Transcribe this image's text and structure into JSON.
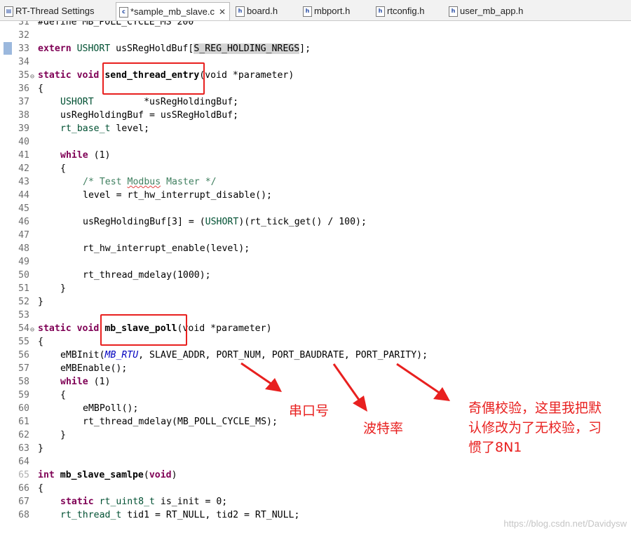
{
  "tabs": [
    {
      "label": "RT-Thread Settings",
      "icon": "settings-icon",
      "icon_glyph": "▤"
    },
    {
      "label": "*sample_mb_slave.c",
      "icon": "c-file-icon",
      "icon_glyph": "c",
      "close": "✕"
    },
    {
      "label": "board.h",
      "icon": "h-file-icon",
      "icon_glyph": "h"
    },
    {
      "label": "mbport.h",
      "icon": "h-file-icon",
      "icon_glyph": "h"
    },
    {
      "label": "rtconfig.h",
      "icon": "h-file-icon",
      "icon_glyph": "h"
    },
    {
      "label": "user_mb_app.h",
      "icon": "h-file-icon",
      "icon_glyph": "h"
    }
  ],
  "lines": {
    "n31": "31",
    "n32": "32",
    "n33": "33",
    "n34": "34",
    "n35": "35",
    "n36": "36",
    "n37": "37",
    "n38": "38",
    "n39": "39",
    "n40": "40",
    "n41": "41",
    "n42": "42",
    "n43": "43",
    "n44": "44",
    "n45": "45",
    "n46": "46",
    "n47": "47",
    "n48": "48",
    "n49": "49",
    "n50": "50",
    "n51": "51",
    "n52": "52",
    "n53": "53",
    "n54": "54",
    "n55": "55",
    "n56": "56",
    "n57": "57",
    "n58": "58",
    "n59": "59",
    "n60": "60",
    "n61": "61",
    "n62": "62",
    "n63": "63",
    "n64": "64",
    "n65": "65",
    "n66": "66",
    "n67": "67",
    "n68": "68"
  },
  "code": {
    "l31": "#define MB_POLL_CYCLE_MS 200",
    "l33_kw": "extern",
    "l33_ty": " USHORT",
    "l33_a": " usSRegHoldBuf[",
    "l33_sel": "S_REG_HOLDING_NREGS",
    "l33_b": "];",
    "static": "static",
    "void": "void",
    "l35_fn": "send_thread_entry",
    "l35_rest": "(void *parameter)",
    "open": "{",
    "close": "}",
    "l37_ty": "USHORT",
    "l37_rest": "         *usRegHoldingBuf;",
    "l38": "usRegHoldingBuf = usSRegHoldBuf;",
    "l39_ty": "rt_base_t",
    "l39_rest": " level;",
    "while": "while",
    "l41_rest": " (1)",
    "l43_a": "/* Test ",
    "l43_sq": "Modbus",
    "l43_b": " Master */",
    "l44": "level = rt_hw_interrupt_disable();",
    "l46_a": "usRegHoldingBuf[3] = (",
    "l46_ty": "USHORT",
    "l46_b": ")(rt_tick_get() / 100);",
    "l48": "rt_hw_interrupt_enable(level);",
    "l50": "rt_thread_mdelay(1000);",
    "l54_fn": "mb_slave_poll",
    "l54_rest": "(void *parameter)",
    "l56_a": "eMBInit(",
    "l56_it": "MB_RTU",
    "l56_b": ", SLAVE_ADDR, PORT_NUM, PORT_BAUDRATE, PORT_PARITY);",
    "l57": "eMBEnable();",
    "l58_rest": " (1)",
    "l60": "eMBPoll();",
    "l61": "rt_thread_mdelay(MB_POLL_CYCLE_MS);",
    "int": "int",
    "l65_fn": " mb_slave_samlpe",
    "l65_a": "(",
    "l65_b": ")",
    "l67_ty": " rt_uint8_t",
    "l67_rest": " is_init = 0;",
    "l68_ty": "rt_thread_t",
    "l68_rest": " tid1 = RT_NULL, tid2 = RT_NULL;"
  },
  "annotations": {
    "port": "串口号",
    "baud": "波特率",
    "parity_line1": "奇偶校验，这里我把默",
    "parity_line2": "认修改为了无校验，习",
    "parity_line3": "惯了8N1"
  },
  "watermark": "https://blog.csdn.net/Davidysw",
  "colors": {
    "keyword": "#7f0055",
    "type": "#005032",
    "comment": "#3f7f5f",
    "macro_italic": "#0000c0",
    "annotation_red": "#e8201f"
  }
}
